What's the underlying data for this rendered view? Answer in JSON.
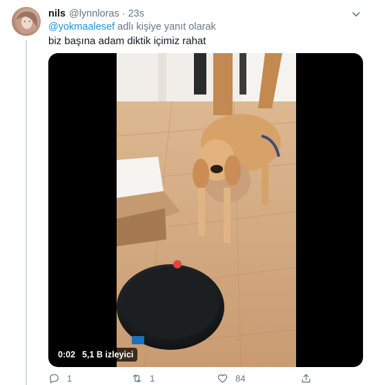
{
  "tweet": {
    "name": "nils",
    "handle": "@lynnloras",
    "separator": "·",
    "time": "23s",
    "reply_to": "@yokmaalesef",
    "reply_suffix": " adlı kişiye yanıt olarak",
    "text": "biz başına adam diktik içimiz rahat"
  },
  "video": {
    "time": "0:02",
    "views": "5,1 B izleyici"
  },
  "actions": {
    "reply_count": "1",
    "retweet_count": "1",
    "like_count": "84"
  },
  "colors": {
    "link": "#1b95e0",
    "secondary": "#657786",
    "primary_text": "#14171a"
  },
  "icons": [
    "reply-icon",
    "retweet-icon",
    "like-icon",
    "share-icon",
    "chevron-down-icon"
  ]
}
